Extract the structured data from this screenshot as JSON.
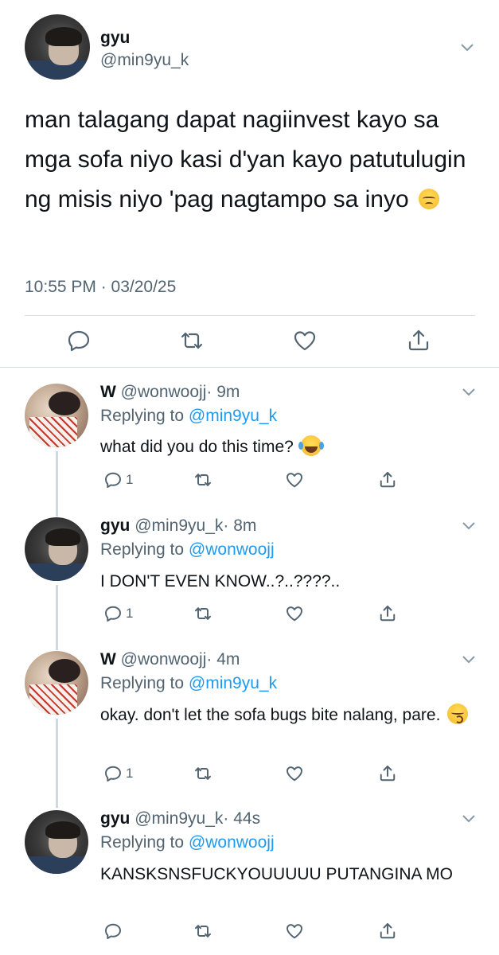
{
  "main_tweet": {
    "name": "gyu",
    "handle": "@min9yu_k",
    "text": "man talagang dapat nagiinvest kayo sa mga sofa niyo kasi d'yan kayo patutulugin ng misis niyo 'pag nagtampo sa inyo",
    "emoji": "pensive-face",
    "timestamp": "10:55 PM · 03/20/25",
    "actions": [
      "reply-icon",
      "retweet-icon",
      "like-icon",
      "share-icon"
    ]
  },
  "replies": [
    {
      "name": "W",
      "handle": "@wonwoojj",
      "time": "· 9m",
      "replying_label": "Replying to",
      "replying_to": "@min9yu_k",
      "text": "what did you do this time?",
      "emoji": "face-with-tears-of-joy",
      "reply_count": "1"
    },
    {
      "name": "gyu",
      "handle": "@min9yu_k",
      "time": "· 8m",
      "replying_label": "Replying to",
      "replying_to": "@wonwoojj",
      "text": "I DON'T EVEN KNOW..?..????..",
      "emoji": "",
      "reply_count": "1"
    },
    {
      "name": "W",
      "handle": "@wonwoojj",
      "time": "· 4m",
      "replying_label": "Replying to",
      "replying_to": "@min9yu_k",
      "text": "okay. don't let the sofa bugs bite nalang, pare.",
      "emoji": "kissing-face-with-smiling-eyes",
      "reply_count": "1"
    },
    {
      "name": "gyu",
      "handle": "@min9yu_k",
      "time": "· 44s",
      "replying_label": "Replying to",
      "replying_to": "@wonwoojj",
      "text": "KANSKSNSFUCKYOUUUUU PUTANGINA MO",
      "emoji": "",
      "reply_count": ""
    }
  ],
  "colors": {
    "text": "#0f1419",
    "secondary": "#536471",
    "link": "#1d9bf0",
    "divider": "#d9dee3",
    "thread_line": "#cfd9de"
  }
}
